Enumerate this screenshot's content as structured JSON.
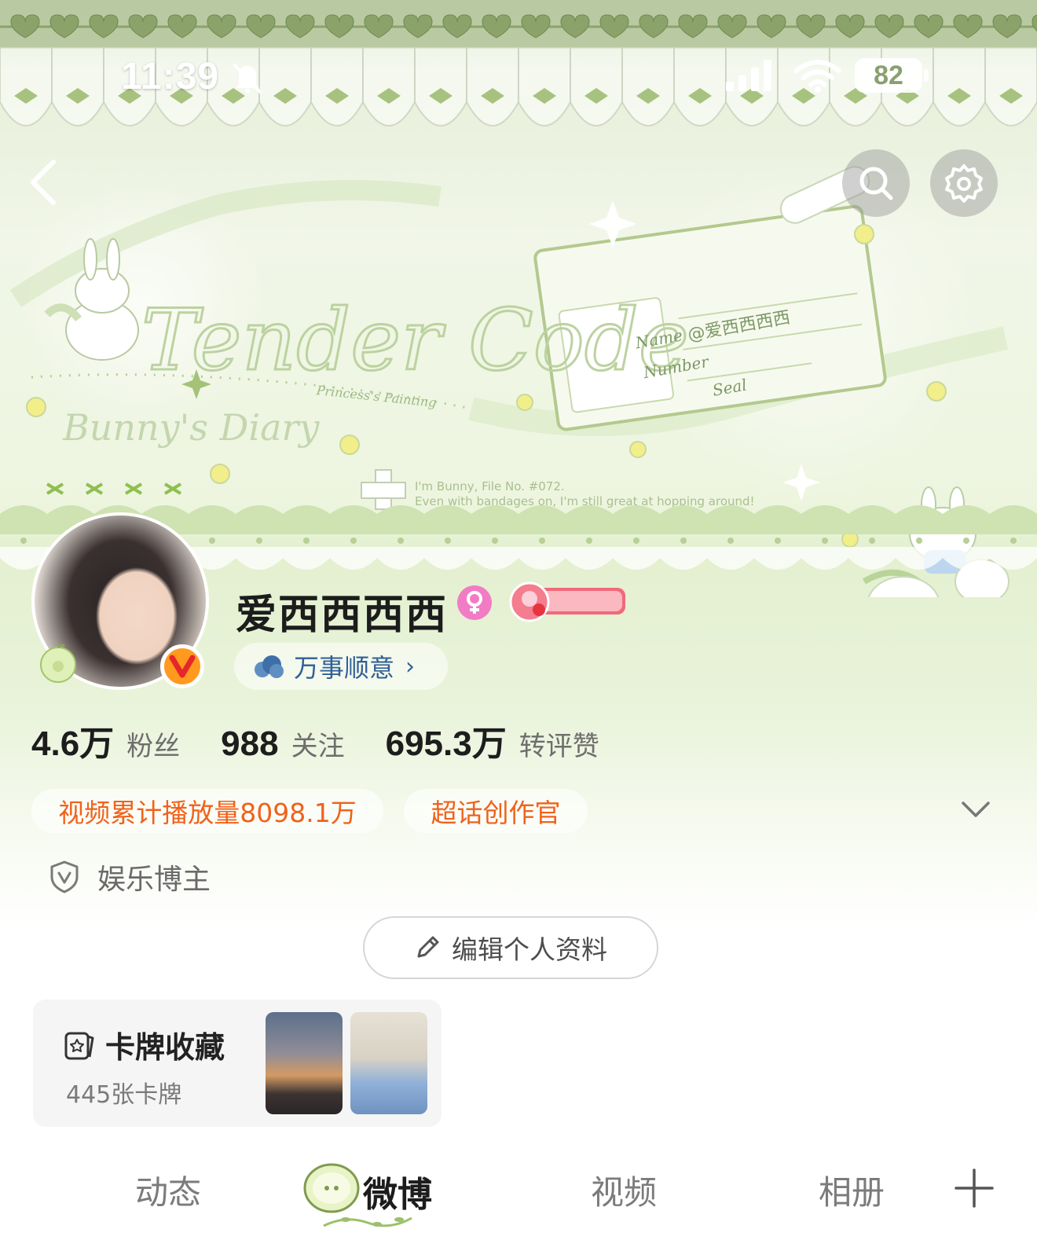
{
  "status_bar": {
    "time": "11:39",
    "battery": "82"
  },
  "banner": {
    "title": "Tender Code",
    "subtitle": "Bunny's Diary",
    "brand": "Princess's Painting",
    "name_label": "Name",
    "name_value": "@爱西西西西",
    "number_label": "Number",
    "seal_label": "Seal",
    "file_line": "I'm Bunny, File No. #072.",
    "quote_line": "Even with bandages on, I'm still great at hopping around!"
  },
  "profile": {
    "name": "爱西西西西",
    "status_label": "万事顺意",
    "status_chevron": "›"
  },
  "stats": [
    {
      "value": "4.6万",
      "label": "粉丝"
    },
    {
      "value": "988",
      "label": "关注"
    },
    {
      "value": "695.3万",
      "label": "转评赞"
    }
  ],
  "tags": {
    "video_plays": "视频累计播放量8098.1万",
    "super_topic": "超话创作官"
  },
  "category": "娱乐博主",
  "edit_button": "编辑个人资料",
  "card_collection": {
    "title": "卡牌收藏",
    "count": "445张卡牌"
  },
  "tabs": [
    "动态",
    "微博",
    "视频",
    "相册"
  ],
  "colors": {
    "accent_orange": "#f0621a",
    "status_blue": "#2f5f96",
    "gender_pink": "#f17cc5",
    "verified_orange": "#ff9a1f",
    "theme_green": "#b9c9a2"
  },
  "icons": {
    "back": "chevron-left-icon",
    "search": "search-icon",
    "settings": "gear-icon",
    "gender": "female-icon",
    "verified": "v-verified-icon",
    "status": "cloud-icon",
    "category": "shield-icon",
    "edit": "pencil-icon",
    "card": "card-icon",
    "add": "plus-icon",
    "expand": "chevron-down-icon"
  }
}
